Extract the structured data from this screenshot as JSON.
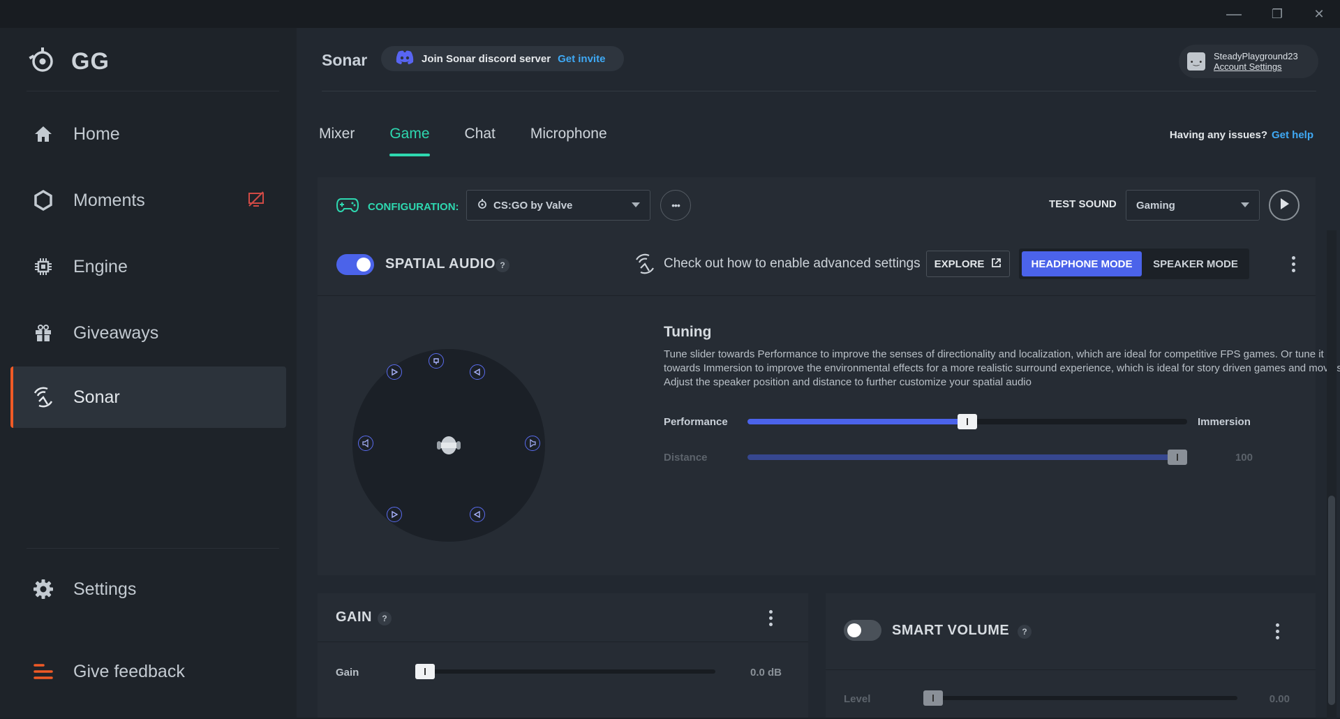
{
  "window": {
    "minimize": "—",
    "restore": "❐",
    "close": "✕"
  },
  "sidebar": {
    "brand": "GG",
    "items": [
      {
        "label": "Home",
        "icon": "home-icon"
      },
      {
        "label": "Moments",
        "icon": "hexagon-icon",
        "badge_icon": "screen-off-icon"
      },
      {
        "label": "Engine",
        "icon": "chip-icon"
      },
      {
        "label": "Giveaways",
        "icon": "gift-icon"
      },
      {
        "label": "Sonar",
        "icon": "sonar-icon",
        "active": true
      },
      {
        "label": "Settings",
        "icon": "gear-icon"
      },
      {
        "label": "Give feedback",
        "icon": "feedback-icon"
      }
    ]
  },
  "header": {
    "title": "Sonar",
    "discord_text": "Join Sonar discord server",
    "discord_link": "Get invite",
    "account_name": "SteadyPlayground23",
    "account_link": "Account Settings"
  },
  "tabs": [
    "Mixer",
    "Game",
    "Chat",
    "Microphone"
  ],
  "active_tab": "Game",
  "issues": {
    "text": "Having any issues?",
    "link": "Get help"
  },
  "config": {
    "label": "CONFIGURATION:",
    "selected": "CS:GO by Valve",
    "more": "•••",
    "test_sound_label": "TEST SOUND",
    "test_sound_selected": "Gaming"
  },
  "spatial": {
    "title": "SPATIAL AUDIO",
    "help": "?",
    "enabled": true,
    "advanced_text": "Check out how to enable advanced settings",
    "explore": "EXPLORE",
    "modes": [
      "HEADPHONE MODE",
      "SPEAKER MODE"
    ],
    "active_mode": "HEADPHONE MODE",
    "tuning_title": "Tuning",
    "tuning_desc": "Tune slider towards Performance to improve the senses of directionality and localization, which are ideal for competitive FPS games. Or tune it towards Immersion to improve the environmental effects for a more realistic surround experience, which is ideal for story driven games and movies. Adjust the speaker position and distance to further customize your spatial audio",
    "performance_label": "Performance",
    "immersion_label": "Immersion",
    "tuning_value": 0.5,
    "distance_label": "Distance",
    "distance_value": "100",
    "distance_fraction": 1.0
  },
  "gain": {
    "title": "GAIN",
    "help": "?",
    "label": "Gain",
    "value": "0.0 dB",
    "fraction": 0.0
  },
  "smart_volume": {
    "title": "SMART VOLUME",
    "help": "?",
    "enabled": false,
    "label": "Level",
    "value": "0.00",
    "fraction": 0.0
  },
  "colors": {
    "accent_teal": "#2ed8b0",
    "accent_blue": "#4b63ea",
    "accent_orange": "#ef5a26",
    "link_blue": "#3fa9f5"
  }
}
